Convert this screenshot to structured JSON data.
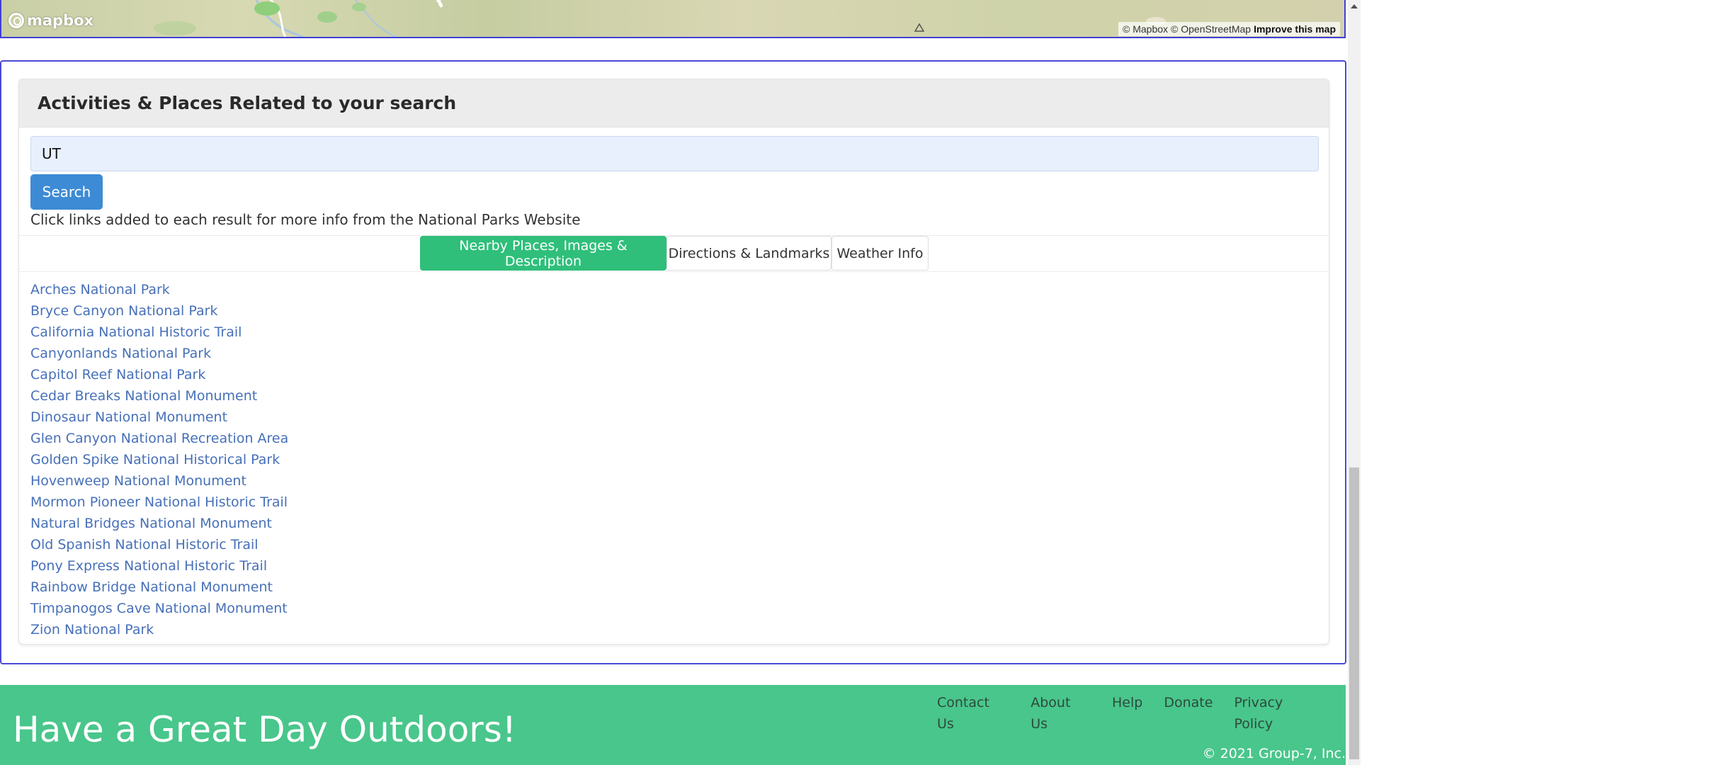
{
  "map": {
    "logo_text": "mapbox",
    "attribution": {
      "mapbox": "© Mapbox",
      "osm": "© OpenStreetMap",
      "improve": "Improve this map"
    }
  },
  "activities": {
    "header": "Activities & Places Related to your search",
    "search_value": "UT",
    "search_button": "Search",
    "help_text": "Click links added to each result for more info from the National Parks Website",
    "tabs": [
      {
        "label": "Nearby Places, Images & Description",
        "active": true
      },
      {
        "label": "Directions & Landmarks",
        "active": false
      },
      {
        "label": "Weather Info",
        "active": false
      }
    ],
    "results": [
      "Arches National Park",
      "Bryce Canyon National Park",
      "California National Historic Trail",
      "Canyonlands National Park",
      "Capitol Reef National Park",
      "Cedar Breaks National Monument",
      "Dinosaur National Monument",
      "Glen Canyon National Recreation Area",
      "Golden Spike National Historical Park",
      "Hovenweep National Monument",
      "Mormon Pioneer National Historic Trail",
      "Natural Bridges National Monument",
      "Old Spanish National Historic Trail",
      "Pony Express National Historic Trail",
      "Rainbow Bridge National Monument",
      "Timpanogos Cave National Monument",
      "Zion National Park"
    ]
  },
  "footer": {
    "tagline": "Have a Great Day Outdoors!",
    "links": [
      "Contact Us",
      "About Us",
      "Help",
      "Donate",
      "Privacy Policy"
    ],
    "copyright": "© 2021 Group-7, Inc."
  },
  "colors": {
    "accent_green": "#2fbf7a",
    "footer_green": "#49c68b",
    "search_blue": "#3d8bd5",
    "link_blue": "#4770b8",
    "section_border": "#4a4ad6"
  },
  "icons": [
    "mapbox-logo-icon",
    "scroll-up-arrow-icon"
  ]
}
